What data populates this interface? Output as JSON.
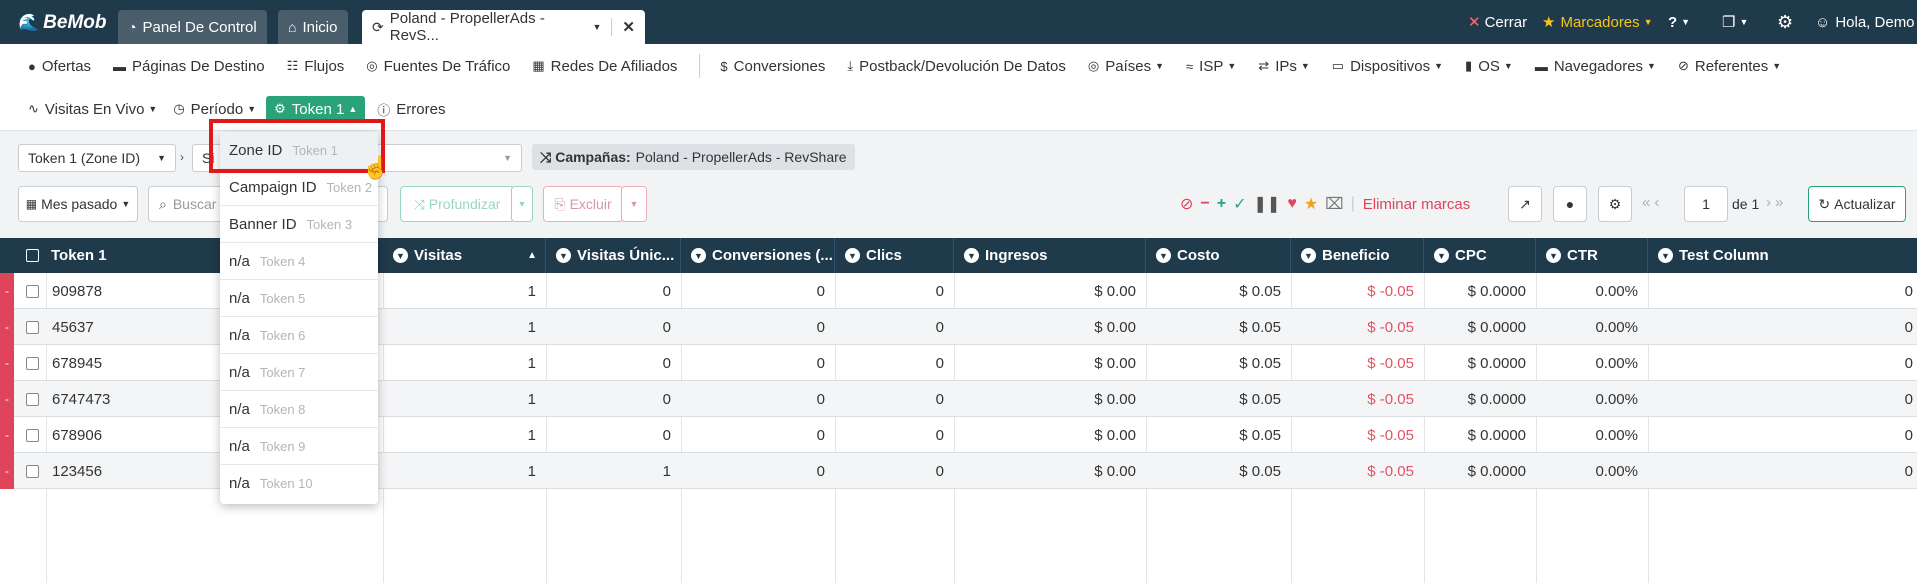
{
  "topbar": {
    "brand": "BeMob",
    "tabs": [
      {
        "label": "Panel De Control"
      },
      {
        "label": "Inicio"
      },
      {
        "label": "Poland - PropellerAds - RevS..."
      }
    ],
    "close_label": "Cerrar",
    "bookmarks_label": "Marcadores",
    "user_label": "Hola, Demo",
    "colors": {
      "bar": "#1f3a4a",
      "bookmarks": "#f5c518"
    }
  },
  "nav1": [
    {
      "label": "Ofertas",
      "icon": "offer-icon"
    },
    {
      "label": "Páginas De Destino",
      "icon": "landing-page-icon"
    },
    {
      "label": "Flujos",
      "icon": "flow-icon"
    },
    {
      "label": "Fuentes De Tráfico",
      "icon": "globe-icon"
    },
    {
      "label": "Redes De Afiliados",
      "icon": "grid-icon"
    },
    {
      "label": "Conversiones",
      "icon": "dollar-icon"
    },
    {
      "label": "Postback/Devolución De Datos",
      "icon": "download-icon"
    },
    {
      "label": "Países",
      "icon": "globe-icon"
    },
    {
      "label": "ISP",
      "icon": "wifi-icon"
    },
    {
      "label": "IPs",
      "icon": "exchange-icon"
    },
    {
      "label": "Dispositivos",
      "icon": "laptop-icon"
    },
    {
      "label": "OS",
      "icon": "mobile-icon"
    },
    {
      "label": "Navegadores",
      "icon": "browser-icon"
    },
    {
      "label": "Referentes",
      "icon": "referrer-icon"
    }
  ],
  "nav2": [
    {
      "label": "Visitas En Vivo",
      "icon": "pulse-icon"
    },
    {
      "label": "Período",
      "icon": "clock-icon"
    },
    {
      "label": "Token 1",
      "icon": "gears-icon",
      "active": true
    },
    {
      "label": "Errores",
      "icon": "alert-icon"
    }
  ],
  "filters": {
    "group_select": "Token 1 (Zone ID)",
    "second_select_partial": "Si",
    "campaign_label": "Campañas:",
    "campaign_value": "Poland - PropellerAds - RevShare",
    "period_label": "Mes pasado",
    "search_placeholder": "Buscar",
    "drilldown_label": "Profundizar",
    "exclude_label": "Excluir",
    "remove_marks_label": "Eliminar marcas",
    "page_value": "1",
    "page_of": "de 1",
    "refresh_label": "Actualizar"
  },
  "table": {
    "columns": [
      "Token 1",
      "Visitas",
      "Visitas Únic...",
      "Conversiones (...",
      "Clics",
      "Ingresos",
      "Costo",
      "Beneficio",
      "CPC",
      "CTR",
      "Test Column"
    ],
    "rows": [
      {
        "token": "909878",
        "visits": "1",
        "unique": "0",
        "conversions": "0",
        "clicks": "0",
        "revenue": "$ 0.00",
        "cost": "$ 0.05",
        "profit": "$ -0.05",
        "cpc": "$ 0.0000",
        "ctr": "0.00%",
        "test": "0"
      },
      {
        "token": "45637",
        "visits": "1",
        "unique": "0",
        "conversions": "0",
        "clicks": "0",
        "revenue": "$ 0.00",
        "cost": "$ 0.05",
        "profit": "$ -0.05",
        "cpc": "$ 0.0000",
        "ctr": "0.00%",
        "test": "0"
      },
      {
        "token": "678945",
        "visits": "1",
        "unique": "0",
        "conversions": "0",
        "clicks": "0",
        "revenue": "$ 0.00",
        "cost": "$ 0.05",
        "profit": "$ -0.05",
        "cpc": "$ 0.0000",
        "ctr": "0.00%",
        "test": "0"
      },
      {
        "token": "6747473",
        "visits": "1",
        "unique": "0",
        "conversions": "0",
        "clicks": "0",
        "revenue": "$ 0.00",
        "cost": "$ 0.05",
        "profit": "$ -0.05",
        "cpc": "$ 0.0000",
        "ctr": "0.00%",
        "test": "0"
      },
      {
        "token": "678906",
        "visits": "1",
        "unique": "0",
        "conversions": "0",
        "clicks": "0",
        "revenue": "$ 0.00",
        "cost": "$ 0.05",
        "profit": "$ -0.05",
        "cpc": "$ 0.0000",
        "ctr": "0.00%",
        "test": "0"
      },
      {
        "token": "123456",
        "visits": "1",
        "unique": "1",
        "conversions": "0",
        "clicks": "0",
        "revenue": "$ 0.00",
        "cost": "$ 0.05",
        "profit": "$ -0.05",
        "cpc": "$ 0.0000",
        "ctr": "0.00%",
        "test": "0"
      }
    ],
    "row_marker": "-"
  },
  "token_dropdown": [
    {
      "label": "Zone ID",
      "sub": "Token 1"
    },
    {
      "label": "Campaign ID",
      "sub": "Token 2"
    },
    {
      "label": "Banner ID",
      "sub": "Token 3"
    },
    {
      "label": "n/a",
      "sub": "Token 4"
    },
    {
      "label": "n/a",
      "sub": "Token 5"
    },
    {
      "label": "n/a",
      "sub": "Token 6"
    },
    {
      "label": "n/a",
      "sub": "Token 7"
    },
    {
      "label": "n/a",
      "sub": "Token 8"
    },
    {
      "label": "n/a",
      "sub": "Token 9"
    },
    {
      "label": "n/a",
      "sub": "Token 10"
    }
  ]
}
